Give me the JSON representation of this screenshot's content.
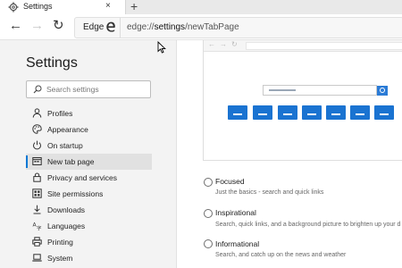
{
  "tab": {
    "title": "Settings",
    "close": "×",
    "new_tab": "+"
  },
  "toolbar": {
    "back": "←",
    "forward": "→",
    "refresh": "↻",
    "edge_label": "Edge",
    "url_prefix": "edge://",
    "url_bold": "settings",
    "url_suffix": "/newTabPage"
  },
  "sidebar": {
    "title": "Settings",
    "search_placeholder": "Search settings",
    "items": [
      {
        "label": "Profiles",
        "icon": "person-icon"
      },
      {
        "label": "Appearance",
        "icon": "palette-icon"
      },
      {
        "label": "On startup",
        "icon": "power-icon"
      },
      {
        "label": "New tab page",
        "icon": "newtab-icon",
        "active": true
      },
      {
        "label": "Privacy and services",
        "icon": "lock-icon"
      },
      {
        "label": "Site permissions",
        "icon": "grid-icon"
      },
      {
        "label": "Downloads",
        "icon": "download-icon"
      },
      {
        "label": "Languages",
        "icon": "language-icon"
      },
      {
        "label": "Printing",
        "icon": "printer-icon"
      },
      {
        "label": "System",
        "icon": "laptop-icon"
      }
    ]
  },
  "options": [
    {
      "title": "Focused",
      "description": "Just the basics - search and quick links"
    },
    {
      "title": "Inspirational",
      "description": "Search, quick links, and a background picture to brighten up your d"
    },
    {
      "title": "Informational",
      "description": "Search, and catch up on the news and weather"
    }
  ],
  "colors": {
    "accent": "#0078d4",
    "tile": "#1a73d1",
    "sidebar_bg": "#f3f3f3"
  }
}
